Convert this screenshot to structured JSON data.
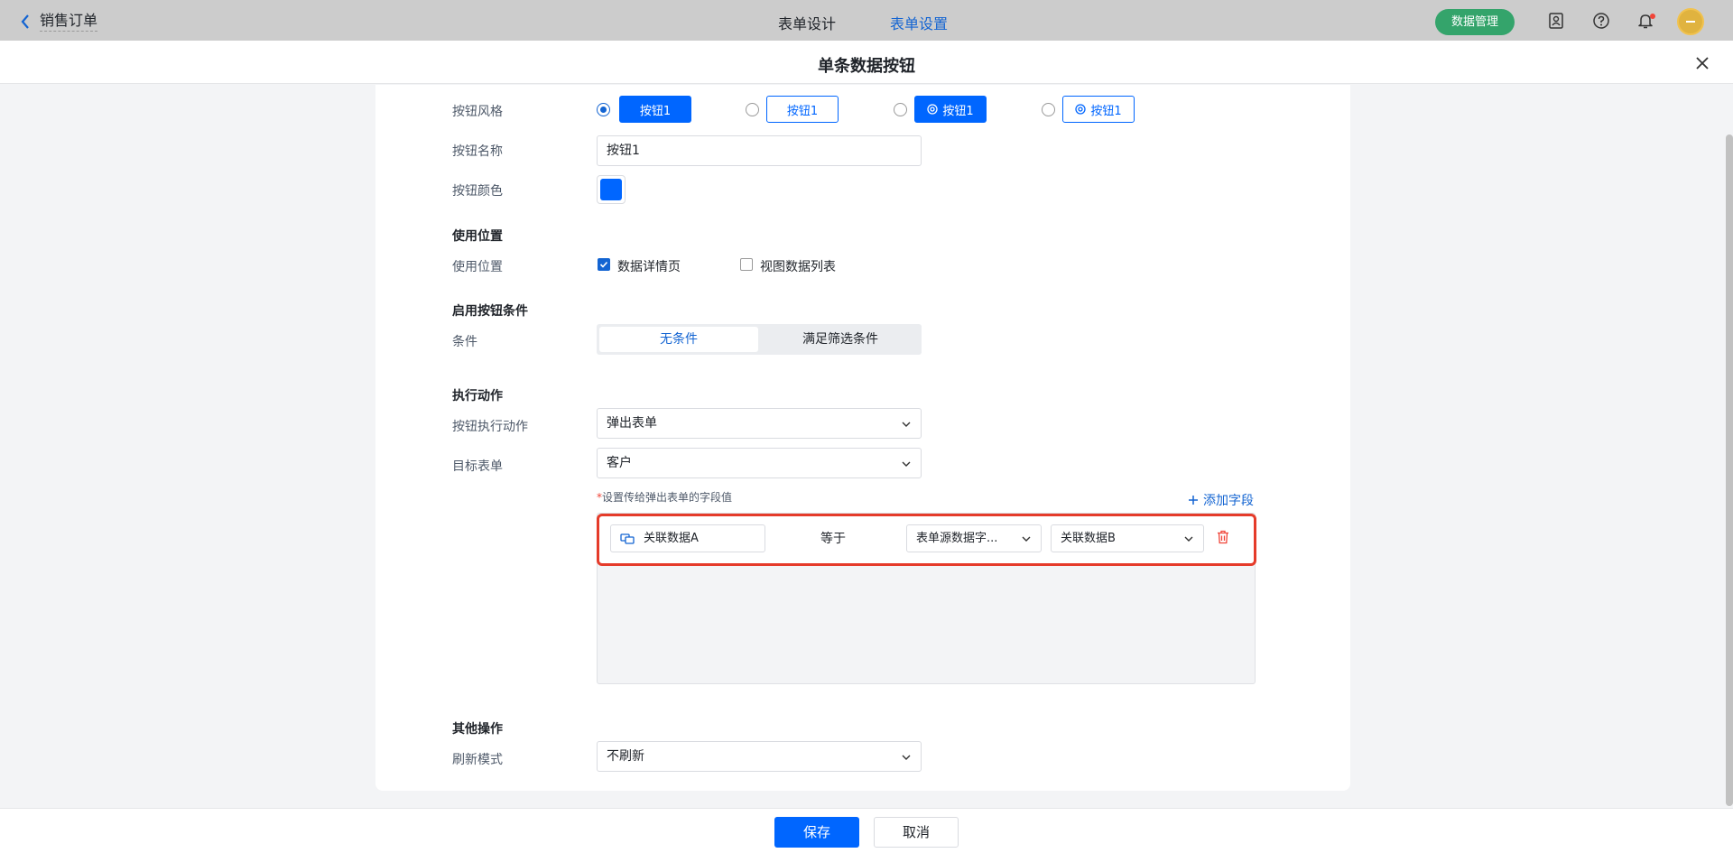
{
  "topbar": {
    "app_title": "销售订单",
    "tabs": [
      {
        "label": "表单设计"
      },
      {
        "label": "表单设置"
      }
    ],
    "active_tab": 1,
    "data_mgmt": "数据管理"
  },
  "modal": {
    "title": "单条数据按钮"
  },
  "button_style": {
    "label": "按钮风格",
    "options": [
      {
        "text": "按钮1"
      },
      {
        "text": "按钮1"
      },
      {
        "text": "按钮1"
      },
      {
        "text": "按钮1"
      }
    ],
    "selected": 0
  },
  "button_name": {
    "label": "按钮名称",
    "value": "按钮1"
  },
  "button_color": {
    "label": "按钮颜色",
    "value": "#0066ff"
  },
  "usage": {
    "section": "使用位置",
    "label": "使用位置",
    "options": [
      {
        "text": "数据详情页",
        "checked": true
      },
      {
        "text": "视图数据列表",
        "checked": false
      }
    ]
  },
  "condition": {
    "section": "启用按钮条件",
    "label": "条件",
    "options": [
      {
        "text": "无条件"
      },
      {
        "text": "满足筛选条件"
      }
    ],
    "selected": 0
  },
  "action": {
    "section": "执行动作",
    "action_label": "按钮执行动作",
    "action_value": "弹出表单",
    "target_label": "目标表单",
    "target_value": "客户",
    "hint_star": "*",
    "hint": "设置传给弹出表单的字段值",
    "add_field": "添加字段",
    "mapping": {
      "field": "关联数据A",
      "op": "等于",
      "source": "表单源数据字...",
      "value": "关联数据B"
    }
  },
  "other": {
    "section": "其他操作",
    "refresh_label": "刷新模式",
    "refresh_value": "不刷新"
  },
  "footer": {
    "save": "保存",
    "cancel": "取消"
  },
  "colors": {
    "primary": "#0066ff",
    "link": "#1364d2",
    "highlight": "#e53b2a",
    "green": "#34a46b"
  }
}
